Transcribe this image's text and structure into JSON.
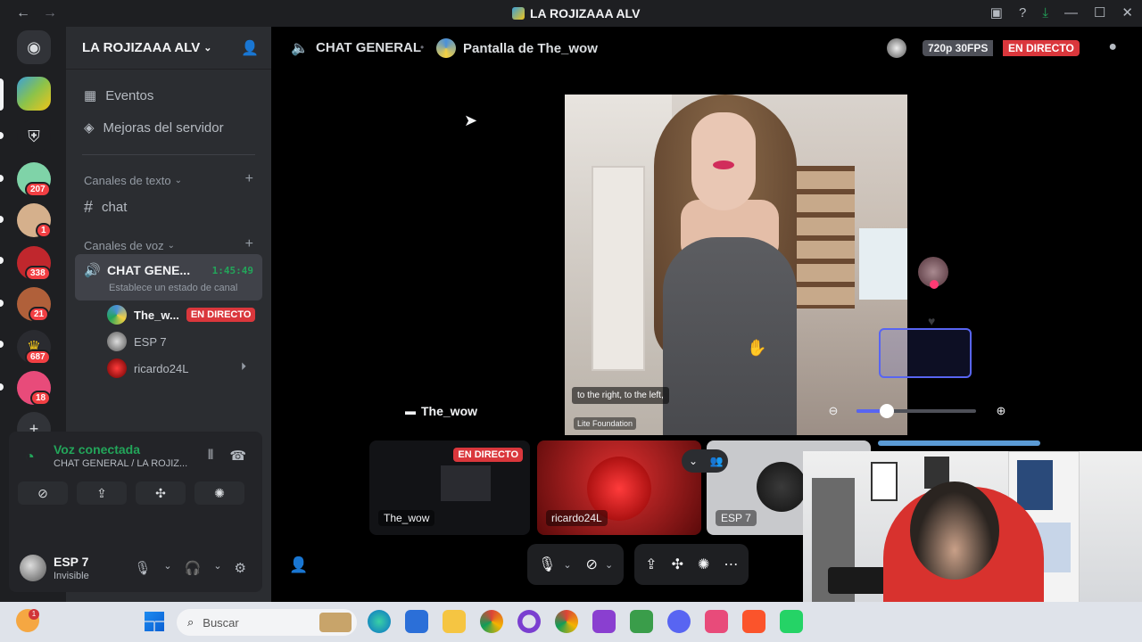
{
  "window": {
    "title": "LA ROJIZAAA ALV"
  },
  "rail": {
    "badges": [
      "207",
      "1",
      "338",
      "21",
      "687",
      "18"
    ]
  },
  "sidebar": {
    "server_name": "LA ROJIZAAA ALV",
    "events": "Eventos",
    "boosts": "Mejoras del servidor",
    "text_category": "Canales de texto",
    "text_channel": "chat",
    "voice_category": "Canales de voz",
    "voice_channel": {
      "name": "CHAT GENE...",
      "time": "1:45:49",
      "status": "Establece un estado de canal"
    },
    "members": [
      {
        "name": "The_w...",
        "live": "EN DIRECTO"
      },
      {
        "name": "ESP 7"
      },
      {
        "name": "ricardo24L"
      }
    ]
  },
  "voice_panel": {
    "title": "Voz conectada",
    "subtitle": "CHAT GENERAL / LA ROJIZ..."
  },
  "user_panel": {
    "name": "ESP 7",
    "status": "Invisible"
  },
  "stage": {
    "channel": "CHAT GENERAL",
    "screen_title": "Pantalla de The_wow",
    "quality": "720p 30FPS",
    "live": "EN DIRECTO",
    "caption": "to the right, to the left,",
    "foundation": "Lite Foundation",
    "stream_label": "The_wow",
    "zoom_level": 0.25
  },
  "tiles": [
    {
      "label": "The_wow",
      "live": "EN DIRECTO"
    },
    {
      "label": "ricardo24L"
    },
    {
      "label": "ESP 7"
    }
  ],
  "taskbar": {
    "search_placeholder": "Buscar",
    "notification_badge": "1"
  },
  "colors": {
    "accent": "#5865f2",
    "live_red": "#da373c",
    "connected_green": "#23a55a"
  }
}
